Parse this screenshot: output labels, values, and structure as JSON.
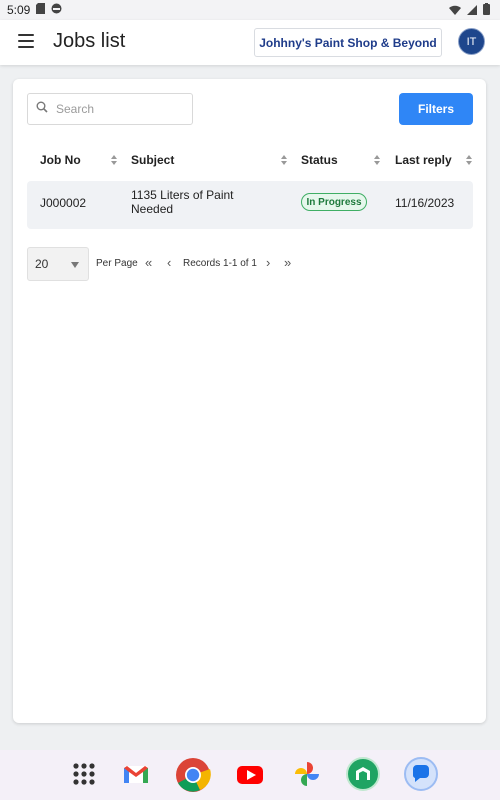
{
  "status_bar": {
    "time": "5:09"
  },
  "app_bar": {
    "title": "Jobs list",
    "shop_name": "Johhny's Paint Shop & Beyond",
    "avatar_initials": "IT"
  },
  "search": {
    "placeholder": "Search"
  },
  "filters_label": "Filters",
  "table": {
    "columns": [
      "Job No",
      "Subject",
      "Status",
      "Last reply"
    ],
    "rows": [
      {
        "job_no": "J000002",
        "subject_line1": "1135 Liters of Paint",
        "subject_line2": "Needed",
        "status": "In Progress",
        "last_reply": "11/16/2023"
      }
    ]
  },
  "pagination": {
    "per_page_value": "20",
    "per_page_label": "Per Page",
    "first": "«",
    "prev": "‹",
    "records": "Records 1-1 of 1",
    "next": "›",
    "last": "»"
  },
  "colors": {
    "primary": "#2f86f6",
    "brand_text": "#1f3c8a",
    "status_green": "#1e7a3c"
  },
  "dock_icons": [
    "apps-icon",
    "gmail-icon",
    "chrome-icon",
    "youtube-icon",
    "photos-icon",
    "app-icon",
    "messages-icon"
  ]
}
